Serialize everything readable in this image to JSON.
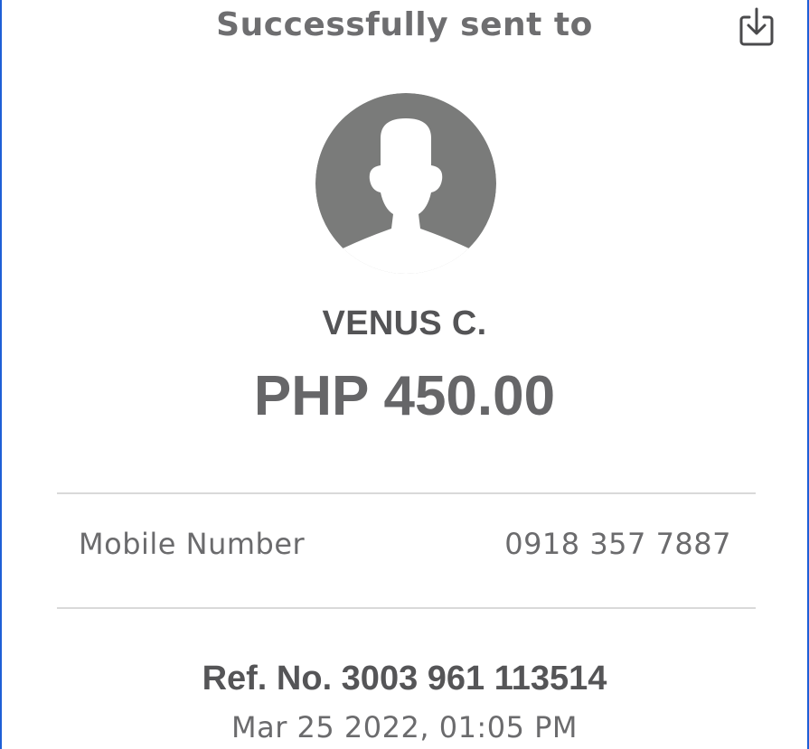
{
  "header": {
    "title": "Successfully sent to",
    "download_icon": "download-icon"
  },
  "recipient": {
    "avatar_icon": "person-silhouette-icon",
    "name": "VENUS C."
  },
  "transaction": {
    "amount": "PHP 450.00",
    "details": [
      {
        "label": "Mobile Number",
        "value": "0918 357 7887"
      }
    ],
    "reference": "Ref. No. 3003 961 113514",
    "datetime": "Mar 25 2022, 01:05 PM"
  },
  "colors": {
    "frame_border": "#1f5fd6",
    "avatar_gray": "#7a7b7a",
    "divider": "#d9d9d9"
  }
}
